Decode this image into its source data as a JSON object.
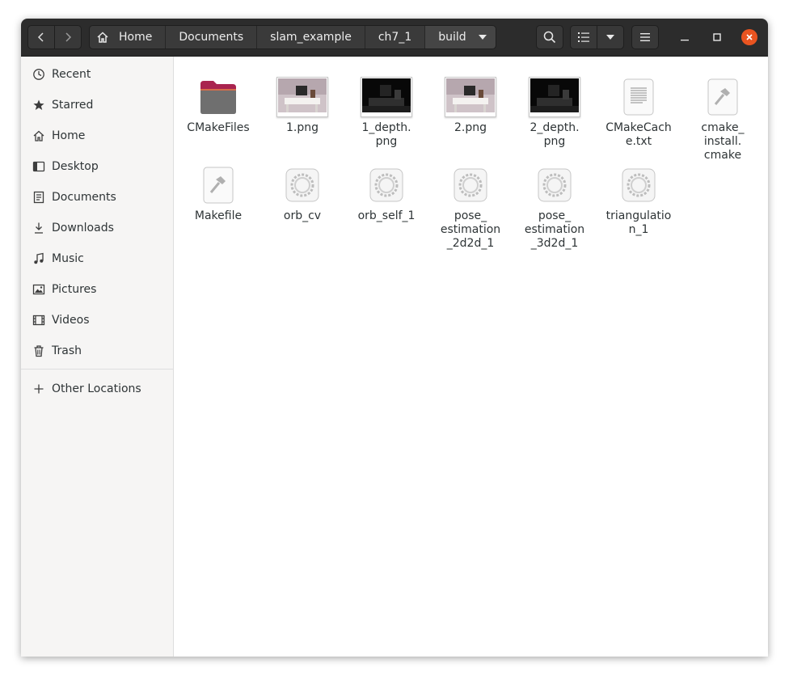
{
  "window": {
    "accent_close": "#e95420"
  },
  "breadcrumb": [
    {
      "label": "Home"
    },
    {
      "label": "Documents"
    },
    {
      "label": "slam_example"
    },
    {
      "label": "ch7_1"
    },
    {
      "label": "build"
    }
  ],
  "sidebar": {
    "items": [
      {
        "label": "Recent",
        "icon": "clock-icon"
      },
      {
        "label": "Starred",
        "icon": "star-icon"
      },
      {
        "label": "Home",
        "icon": "home-icon"
      },
      {
        "label": "Desktop",
        "icon": "desktop-icon"
      },
      {
        "label": "Documents",
        "icon": "documents-icon"
      },
      {
        "label": "Downloads",
        "icon": "download-icon"
      },
      {
        "label": "Music",
        "icon": "music-icon"
      },
      {
        "label": "Pictures",
        "icon": "pictures-icon"
      },
      {
        "label": "Videos",
        "icon": "videos-icon"
      },
      {
        "label": "Trash",
        "icon": "trash-icon"
      }
    ],
    "other_locations": {
      "label": "Other Locations",
      "icon": "plus-icon"
    }
  },
  "files": [
    {
      "label": "CMakeFiles",
      "type": "folder"
    },
    {
      "label": "1.png",
      "type": "image-rgb"
    },
    {
      "label": "1_depth.\npng",
      "type": "image-depth"
    },
    {
      "label": "2.png",
      "type": "image-rgb"
    },
    {
      "label": "2_depth.\npng",
      "type": "image-depth"
    },
    {
      "label": "CMakeCach\ne.txt",
      "type": "text"
    },
    {
      "label": "cmake_\ninstall.\ncmake",
      "type": "script"
    },
    {
      "label": "Makefile",
      "type": "script"
    },
    {
      "label": "orb_cv",
      "type": "executable"
    },
    {
      "label": "orb_self_1",
      "type": "executable"
    },
    {
      "label": "pose_\nestimation\n_2d2d_1",
      "type": "executable"
    },
    {
      "label": "pose_\nestimation\n_3d2d_1",
      "type": "executable"
    },
    {
      "label": "triangulatio\nn_1",
      "type": "executable"
    }
  ]
}
